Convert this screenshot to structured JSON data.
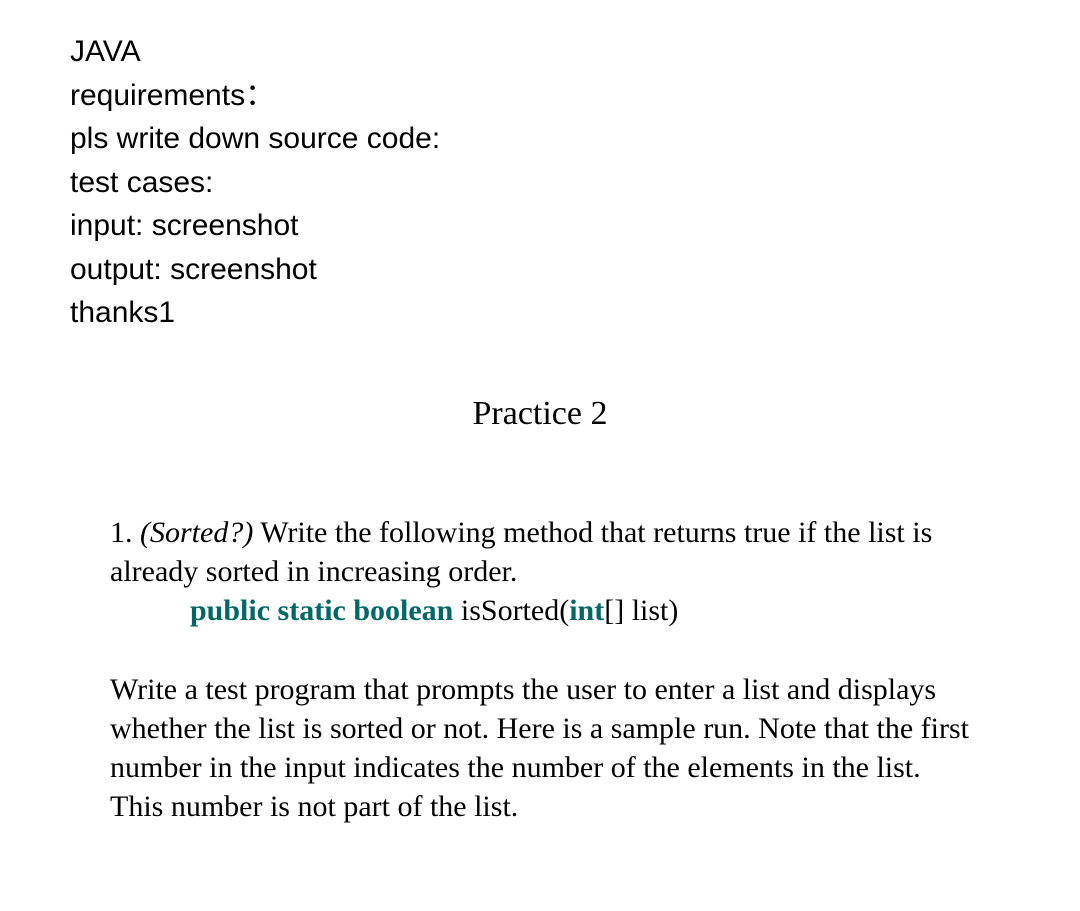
{
  "intro": {
    "line1": "JAVA",
    "line2": "requirements：",
    "line3": "pls write down source code:",
    "line4": "test cases:",
    "line5": "input: screenshot",
    "line6": "output: screenshot",
    "line7": "thanks1"
  },
  "title": "Practice 2",
  "problem": {
    "number": "1. ",
    "label_italic": "(Sorted?)",
    "intro_text": " Write the following method that returns true if the list is already sorted in increasing order.",
    "method": {
      "kw1": "public static boolean",
      "name": " isSorted(",
      "kw2": "int",
      "rest": "[] list)"
    },
    "description": "Write a test program that prompts the user to enter a list and displays whether the list is sorted or not. Here is a sample run. Note that the first number in the input indicates the number of the elements in the list. This number is not part of the list."
  }
}
